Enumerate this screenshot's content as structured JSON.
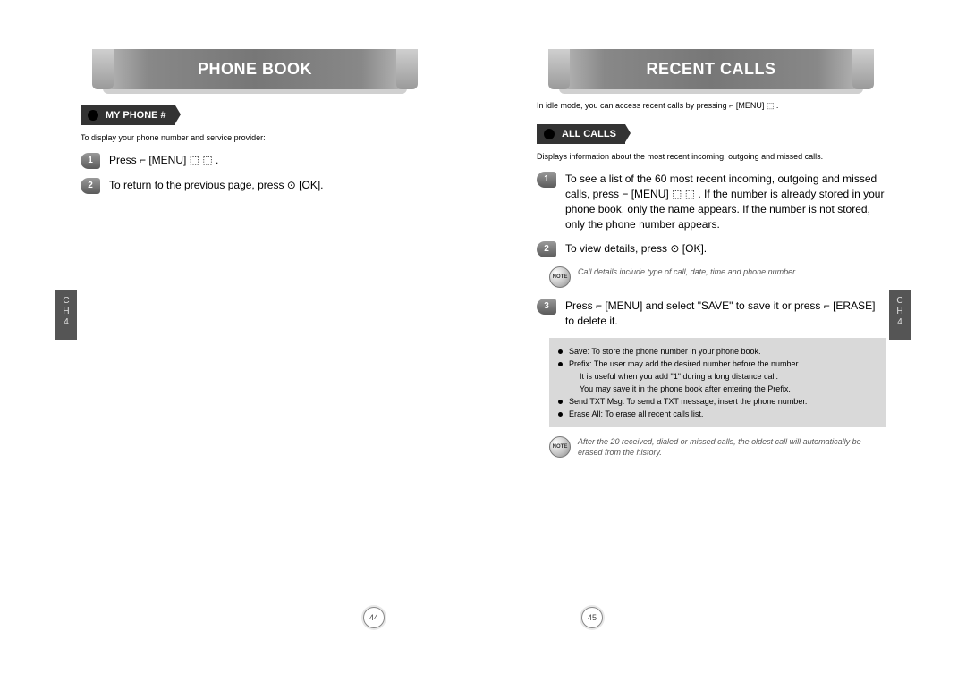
{
  "left": {
    "title": "PHONE BOOK",
    "section_label": "MY PHONE #",
    "intro": "To display your phone number and service provider:",
    "steps": [
      "Press ⌐ [MENU] ⬚ ⬚ .",
      "To return to the previous page, press ⊙ [OK]."
    ],
    "side_tab": "C\nH\n4",
    "page_num": "44"
  },
  "right": {
    "title": "RECENT CALLS",
    "idle_line": "In idle mode, you can access recent calls by pressing ⌐ [MENU] ⬚ .",
    "section_label": "ALL CALLS",
    "intro": "Displays information about the most recent incoming, outgoing and missed calls.",
    "steps": [
      "To see a list of the 60 most recent incoming, outgoing and missed calls, press ⌐ [MENU] ⬚ ⬚ . If the number is already stored in your phone book, only the name appears. If the number is not stored, only the phone number appears.",
      "To view details, press ⊙ [OK].",
      "Press ⌐ [MENU] and select \"SAVE\" to save it or press ⌐ [ERASE] to delete it."
    ],
    "note1": "Call details include type of call, date, time and phone number.",
    "grey_items": [
      "Save: To store the phone number in your phone book.",
      "Prefix: The user may add the desired number before the number.",
      "It is useful when you add \"1\" during a long distance call.",
      "You may save it in the phone book after entering the Prefix.",
      "Send TXT Msg: To send a TXT message, insert the phone number.",
      "Erase All: To erase all recent calls list."
    ],
    "note2": "After the 20 received, dialed or missed calls, the oldest call will automatically be erased from the history.",
    "side_tab": "C\nH\n4",
    "page_num": "45"
  },
  "note_label": "NOTE"
}
